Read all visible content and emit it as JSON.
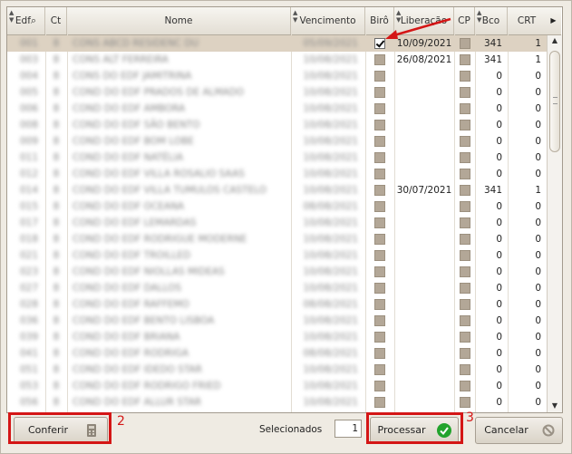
{
  "columns": [
    {
      "label": "Edf",
      "icon": "search-icon"
    },
    {
      "label": "Ct"
    },
    {
      "label": "Nome"
    },
    {
      "label": "Vencimento"
    },
    {
      "label": "Birô"
    },
    {
      "label": "Liberação"
    },
    {
      "label": "CP"
    },
    {
      "label": "Bco"
    },
    {
      "label": "CRT"
    }
  ],
  "rows": [
    {
      "edf": "001",
      "ct": "8",
      "nome": "CONS ABCD RESIDENC DU",
      "venc": "05/09/2021",
      "biro": true,
      "lib": "10/09/2021",
      "bco": "341",
      "crt": "1"
    },
    {
      "edf": "003",
      "ct": "8",
      "nome": "CONS ALT FERREIRA",
      "venc": "10/08/2021",
      "biro": false,
      "lib": "26/08/2021",
      "bco": "341",
      "crt": "1"
    },
    {
      "edf": "004",
      "ct": "8",
      "nome": "CONS DO EDF JAMITRINA",
      "venc": "10/08/2021",
      "biro": false,
      "lib": "",
      "bco": "0",
      "crt": "0"
    },
    {
      "edf": "005",
      "ct": "8",
      "nome": "COND DO EDF PRADOS DE ALMADO",
      "venc": "10/08/2021",
      "biro": false,
      "lib": "",
      "bco": "0",
      "crt": "0"
    },
    {
      "edf": "006",
      "ct": "8",
      "nome": "COND DO EDF AMBORA",
      "venc": "10/08/2021",
      "biro": false,
      "lib": "",
      "bco": "0",
      "crt": "0"
    },
    {
      "edf": "008",
      "ct": "8",
      "nome": "COND DO EDF SÃO BENTO",
      "venc": "10/08/2021",
      "biro": false,
      "lib": "",
      "bco": "0",
      "crt": "0"
    },
    {
      "edf": "009",
      "ct": "8",
      "nome": "COND DO EDF BOM LOBE",
      "venc": "10/08/2021",
      "biro": false,
      "lib": "",
      "bco": "0",
      "crt": "0"
    },
    {
      "edf": "011",
      "ct": "8",
      "nome": "COND DO EDF NATÉLIA",
      "venc": "10/08/2021",
      "biro": false,
      "lib": "",
      "bco": "0",
      "crt": "0"
    },
    {
      "edf": "012",
      "ct": "8",
      "nome": "COND DO EDF VILLA ROSALIO SAAS",
      "venc": "10/08/2021",
      "biro": false,
      "lib": "",
      "bco": "0",
      "crt": "0"
    },
    {
      "edf": "014",
      "ct": "8",
      "nome": "COND DO EDF VILLA TUMULOS CASTELO",
      "venc": "10/08/2021",
      "biro": false,
      "lib": "30/07/2021",
      "bco": "341",
      "crt": "1"
    },
    {
      "edf": "015",
      "ct": "8",
      "nome": "COND DO EDF OCEANA",
      "venc": "08/08/2021",
      "biro": false,
      "lib": "",
      "bco": "0",
      "crt": "0"
    },
    {
      "edf": "017",
      "ct": "8",
      "nome": "COND DO EDF LEMARDAS",
      "venc": "10/08/2021",
      "biro": false,
      "lib": "",
      "bco": "0",
      "crt": "0"
    },
    {
      "edf": "018",
      "ct": "8",
      "nome": "COND DO EDF RODRIGUE MODERNE",
      "venc": "10/08/2021",
      "biro": false,
      "lib": "",
      "bco": "0",
      "crt": "0"
    },
    {
      "edf": "021",
      "ct": "8",
      "nome": "COND DO EDF TROILLED",
      "venc": "10/08/2021",
      "biro": false,
      "lib": "",
      "bco": "0",
      "crt": "0"
    },
    {
      "edf": "023",
      "ct": "8",
      "nome": "COND DO EDF NIOLLAS MIDEAS",
      "venc": "10/08/2021",
      "biro": false,
      "lib": "",
      "bco": "0",
      "crt": "0"
    },
    {
      "edf": "027",
      "ct": "8",
      "nome": "COND DO EDF DALLOS",
      "venc": "10/08/2021",
      "biro": false,
      "lib": "",
      "bco": "0",
      "crt": "0"
    },
    {
      "edf": "028",
      "ct": "8",
      "nome": "COND DO EDF RAFFEMO",
      "venc": "08/08/2021",
      "biro": false,
      "lib": "",
      "bco": "0",
      "crt": "0"
    },
    {
      "edf": "036",
      "ct": "8",
      "nome": "COND DO EDF BENTO LISBOA",
      "venc": "10/08/2021",
      "biro": false,
      "lib": "",
      "bco": "0",
      "crt": "0"
    },
    {
      "edf": "039",
      "ct": "8",
      "nome": "COND DO EDF BRIANA",
      "venc": "10/08/2021",
      "biro": false,
      "lib": "",
      "bco": "0",
      "crt": "0"
    },
    {
      "edf": "041",
      "ct": "8",
      "nome": "COND DO EDF RODRIGA",
      "venc": "08/08/2021",
      "biro": false,
      "lib": "",
      "bco": "0",
      "crt": "0"
    },
    {
      "edf": "051",
      "ct": "8",
      "nome": "COND DO EDF IDEDO STAR",
      "venc": "10/08/2021",
      "biro": false,
      "lib": "",
      "bco": "0",
      "crt": "0"
    },
    {
      "edf": "053",
      "ct": "8",
      "nome": "COND DO EDF RODRIGO FRIED",
      "venc": "10/08/2021",
      "biro": false,
      "lib": "",
      "bco": "0",
      "crt": "0"
    },
    {
      "edf": "056",
      "ct": "8",
      "nome": "COND DO EDF ALLUR STAR",
      "venc": "10/08/2021",
      "biro": false,
      "lib": "",
      "bco": "0",
      "crt": "0"
    }
  ],
  "footer": {
    "conferir_label": "Conferir",
    "selecionados_label": "Selecionados",
    "selecionados_value": "1",
    "processar_label": "Processar",
    "cancelar_label": "Cancelar"
  },
  "annotations": {
    "label_2": "2",
    "label_3": "3",
    "color": "#d41616"
  },
  "colors": {
    "selected_row": "#ddd2c2",
    "checkbox_fill": "#b3a797",
    "processar_check": "#22a32c",
    "cancelar_icon": "#9a9286"
  }
}
